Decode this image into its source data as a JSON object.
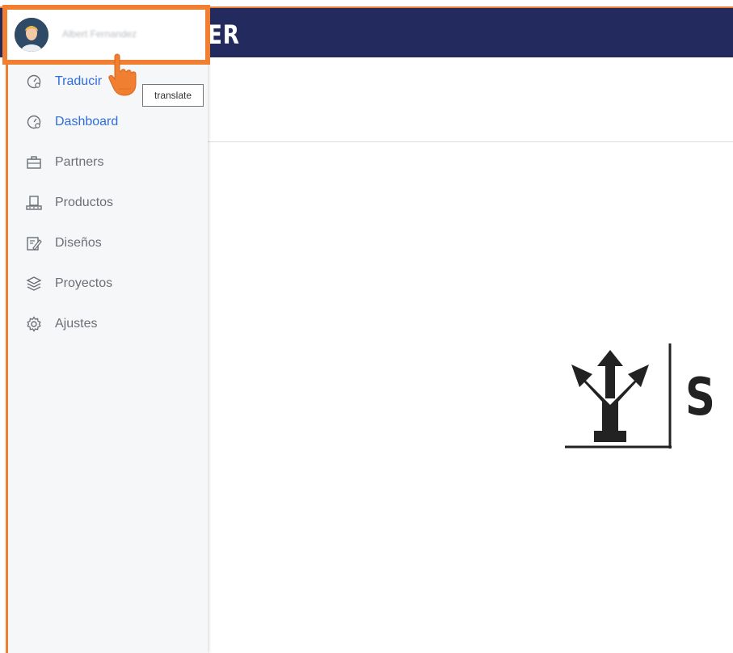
{
  "header": {
    "title": "ER"
  },
  "user": {
    "name": "Albert Fernandez"
  },
  "tooltip": {
    "text": "translate"
  },
  "sidebar": {
    "items": [
      {
        "label": "Traducir",
        "icon": "speedometer-icon",
        "active": true
      },
      {
        "label": "Dashboard",
        "icon": "speedometer-icon",
        "active": true
      },
      {
        "label": "Partners",
        "icon": "briefcase-icon",
        "active": false
      },
      {
        "label": "Productos",
        "icon": "conveyor-icon",
        "active": false
      },
      {
        "label": "Diseños",
        "icon": "pencil-notepad-icon",
        "active": false
      },
      {
        "label": "Proyectos",
        "icon": "layers-icon",
        "active": false
      },
      {
        "label": "Ajustes",
        "icon": "gear-icon",
        "active": false
      }
    ]
  },
  "logo": {
    "letter": "S"
  },
  "colors": {
    "header_bg": "#232b5e",
    "accent": "#f07f31",
    "active_link": "#2d6de0",
    "sidebar_bg": "#f6f7f9"
  }
}
